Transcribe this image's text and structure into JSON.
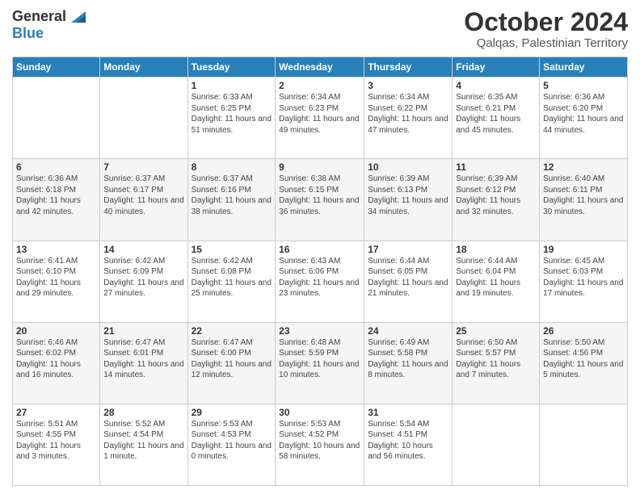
{
  "header": {
    "logo_general": "General",
    "logo_blue": "Blue",
    "month": "October 2024",
    "location": "Qalqas, Palestinian Territory"
  },
  "days_of_week": [
    "Sunday",
    "Monday",
    "Tuesday",
    "Wednesday",
    "Thursday",
    "Friday",
    "Saturday"
  ],
  "weeks": [
    [
      {
        "day": "",
        "sunrise": "",
        "sunset": "",
        "daylight": ""
      },
      {
        "day": "",
        "sunrise": "",
        "sunset": "",
        "daylight": ""
      },
      {
        "day": "1",
        "sunrise": "Sunrise: 6:33 AM",
        "sunset": "Sunset: 6:25 PM",
        "daylight": "Daylight: 11 hours and 51 minutes."
      },
      {
        "day": "2",
        "sunrise": "Sunrise: 6:34 AM",
        "sunset": "Sunset: 6:23 PM",
        "daylight": "Daylight: 11 hours and 49 minutes."
      },
      {
        "day": "3",
        "sunrise": "Sunrise: 6:34 AM",
        "sunset": "Sunset: 6:22 PM",
        "daylight": "Daylight: 11 hours and 47 minutes."
      },
      {
        "day": "4",
        "sunrise": "Sunrise: 6:35 AM",
        "sunset": "Sunset: 6:21 PM",
        "daylight": "Daylight: 11 hours and 45 minutes."
      },
      {
        "day": "5",
        "sunrise": "Sunrise: 6:36 AM",
        "sunset": "Sunset: 6:20 PM",
        "daylight": "Daylight: 11 hours and 44 minutes."
      }
    ],
    [
      {
        "day": "6",
        "sunrise": "Sunrise: 6:36 AM",
        "sunset": "Sunset: 6:18 PM",
        "daylight": "Daylight: 11 hours and 42 minutes."
      },
      {
        "day": "7",
        "sunrise": "Sunrise: 6:37 AM",
        "sunset": "Sunset: 6:17 PM",
        "daylight": "Daylight: 11 hours and 40 minutes."
      },
      {
        "day": "8",
        "sunrise": "Sunrise: 6:37 AM",
        "sunset": "Sunset: 6:16 PM",
        "daylight": "Daylight: 11 hours and 38 minutes."
      },
      {
        "day": "9",
        "sunrise": "Sunrise: 6:38 AM",
        "sunset": "Sunset: 6:15 PM",
        "daylight": "Daylight: 11 hours and 36 minutes."
      },
      {
        "day": "10",
        "sunrise": "Sunrise: 6:39 AM",
        "sunset": "Sunset: 6:13 PM",
        "daylight": "Daylight: 11 hours and 34 minutes."
      },
      {
        "day": "11",
        "sunrise": "Sunrise: 6:39 AM",
        "sunset": "Sunset: 6:12 PM",
        "daylight": "Daylight: 11 hours and 32 minutes."
      },
      {
        "day": "12",
        "sunrise": "Sunrise: 6:40 AM",
        "sunset": "Sunset: 6:11 PM",
        "daylight": "Daylight: 11 hours and 30 minutes."
      }
    ],
    [
      {
        "day": "13",
        "sunrise": "Sunrise: 6:41 AM",
        "sunset": "Sunset: 6:10 PM",
        "daylight": "Daylight: 11 hours and 29 minutes."
      },
      {
        "day": "14",
        "sunrise": "Sunrise: 6:42 AM",
        "sunset": "Sunset: 6:09 PM",
        "daylight": "Daylight: 11 hours and 27 minutes."
      },
      {
        "day": "15",
        "sunrise": "Sunrise: 6:42 AM",
        "sunset": "Sunset: 6:08 PM",
        "daylight": "Daylight: 11 hours and 25 minutes."
      },
      {
        "day": "16",
        "sunrise": "Sunrise: 6:43 AM",
        "sunset": "Sunset: 6:06 PM",
        "daylight": "Daylight: 11 hours and 23 minutes."
      },
      {
        "day": "17",
        "sunrise": "Sunrise: 6:44 AM",
        "sunset": "Sunset: 6:05 PM",
        "daylight": "Daylight: 11 hours and 21 minutes."
      },
      {
        "day": "18",
        "sunrise": "Sunrise: 6:44 AM",
        "sunset": "Sunset: 6:04 PM",
        "daylight": "Daylight: 11 hours and 19 minutes."
      },
      {
        "day": "19",
        "sunrise": "Sunrise: 6:45 AM",
        "sunset": "Sunset: 6:03 PM",
        "daylight": "Daylight: 11 hours and 17 minutes."
      }
    ],
    [
      {
        "day": "20",
        "sunrise": "Sunrise: 6:46 AM",
        "sunset": "Sunset: 6:02 PM",
        "daylight": "Daylight: 11 hours and 16 minutes."
      },
      {
        "day": "21",
        "sunrise": "Sunrise: 6:47 AM",
        "sunset": "Sunset: 6:01 PM",
        "daylight": "Daylight: 11 hours and 14 minutes."
      },
      {
        "day": "22",
        "sunrise": "Sunrise: 6:47 AM",
        "sunset": "Sunset: 6:00 PM",
        "daylight": "Daylight: 11 hours and 12 minutes."
      },
      {
        "day": "23",
        "sunrise": "Sunrise: 6:48 AM",
        "sunset": "Sunset: 5:59 PM",
        "daylight": "Daylight: 11 hours and 10 minutes."
      },
      {
        "day": "24",
        "sunrise": "Sunrise: 6:49 AM",
        "sunset": "Sunset: 5:58 PM",
        "daylight": "Daylight: 11 hours and 8 minutes."
      },
      {
        "day": "25",
        "sunrise": "Sunrise: 6:50 AM",
        "sunset": "Sunset: 5:57 PM",
        "daylight": "Daylight: 11 hours and 7 minutes."
      },
      {
        "day": "26",
        "sunrise": "Sunrise: 5:50 AM",
        "sunset": "Sunset: 4:56 PM",
        "daylight": "Daylight: 11 hours and 5 minutes."
      }
    ],
    [
      {
        "day": "27",
        "sunrise": "Sunrise: 5:51 AM",
        "sunset": "Sunset: 4:55 PM",
        "daylight": "Daylight: 11 hours and 3 minutes."
      },
      {
        "day": "28",
        "sunrise": "Sunrise: 5:52 AM",
        "sunset": "Sunset: 4:54 PM",
        "daylight": "Daylight: 11 hours and 1 minute."
      },
      {
        "day": "29",
        "sunrise": "Sunrise: 5:53 AM",
        "sunset": "Sunset: 4:53 PM",
        "daylight": "Daylight: 11 hours and 0 minutes."
      },
      {
        "day": "30",
        "sunrise": "Sunrise: 5:53 AM",
        "sunset": "Sunset: 4:52 PM",
        "daylight": "Daylight: 10 hours and 58 minutes."
      },
      {
        "day": "31",
        "sunrise": "Sunrise: 5:54 AM",
        "sunset": "Sunset: 4:51 PM",
        "daylight": "Daylight: 10 hours and 56 minutes."
      },
      {
        "day": "",
        "sunrise": "",
        "sunset": "",
        "daylight": ""
      },
      {
        "day": "",
        "sunrise": "",
        "sunset": "",
        "daylight": ""
      }
    ]
  ]
}
